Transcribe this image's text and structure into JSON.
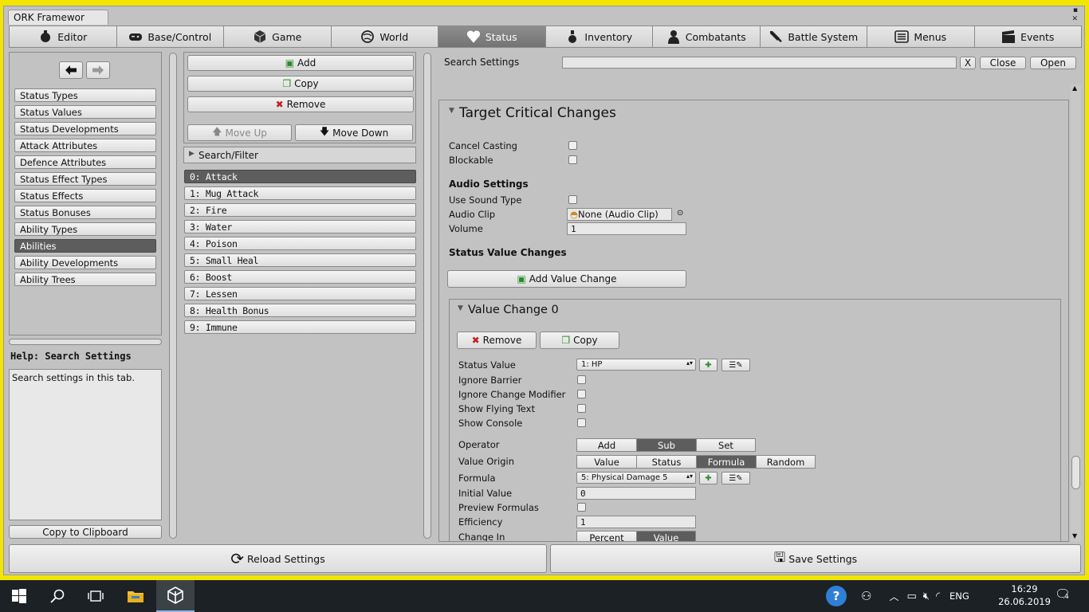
{
  "window": {
    "tab_title": "ORK Framewor",
    "controls": "▪ ✕"
  },
  "nav_tabs": [
    {
      "label": "Editor",
      "icon": "editor-icon"
    },
    {
      "label": "Base/Control",
      "icon": "gamepad-icon"
    },
    {
      "label": "Game",
      "icon": "cube-icon"
    },
    {
      "label": "World",
      "icon": "globe-icon"
    },
    {
      "label": "Status",
      "icon": "heart-icon",
      "active": true
    },
    {
      "label": "Inventory",
      "icon": "potion-icon"
    },
    {
      "label": "Combatants",
      "icon": "person-icon"
    },
    {
      "label": "Battle System",
      "icon": "sword-icon"
    },
    {
      "label": "Menus",
      "icon": "menu-icon"
    },
    {
      "label": "Events",
      "icon": "clapper-icon"
    }
  ],
  "left": {
    "items": [
      "Status Types",
      "Status Values",
      "Status Developments",
      "Attack Attributes",
      "Defence Attributes",
      "Status Effect Types",
      "Status Effects",
      "Status Bonuses",
      "Ability Types",
      "Abilities",
      "Ability Developments",
      "Ability Trees"
    ],
    "selected_index": 9,
    "help_title": "Help: Search Settings",
    "help_text": "Search settings in this tab.",
    "copy_button": "Copy to Clipboard"
  },
  "middle": {
    "add": "Add",
    "copy": "Copy",
    "remove": "Remove",
    "move_up": "Move Up",
    "move_down": "Move Down",
    "search_filter": "Search/Filter",
    "items": [
      "0: Attack",
      "1: Mug Attack",
      "2: Fire",
      "3: Water",
      "4: Poison",
      "5: Small Heal",
      "6: Boost",
      "7: Lessen",
      "8: Health Bonus",
      "9: Immune"
    ],
    "selected_index": 0
  },
  "right": {
    "search_label": "Search Settings",
    "search_value": "",
    "clear": "X",
    "close": "Close",
    "open": "Open",
    "section_title": "Target Critical Changes",
    "cancel_casting": "Cancel Casting",
    "blockable": "Blockable",
    "audio_settings": "Audio Settings",
    "use_sound_type": "Use Sound Type",
    "audio_clip": "Audio Clip",
    "audio_clip_value": "None (Audio Clip)",
    "volume": "Volume",
    "volume_value": "1",
    "status_value_changes": "Status Value Changes",
    "add_value_change": "Add Value Change",
    "value_change_title": "Value Change 0",
    "vc_remove": "Remove",
    "vc_copy": "Copy",
    "status_value": "Status Value",
    "status_value_selected": "1: HP",
    "ignore_barrier": "Ignore Barrier",
    "ignore_change_modifier": "Ignore Change Modifier",
    "show_flying_text": "Show Flying Text",
    "show_console": "Show Console",
    "operator": "Operator",
    "operator_options": [
      "Add",
      "Sub",
      "Set"
    ],
    "operator_selected": 1,
    "value_origin": "Value Origin",
    "value_origin_options": [
      "Value",
      "Status",
      "Formula",
      "Random"
    ],
    "value_origin_selected": 2,
    "formula": "Formula",
    "formula_selected": "5: Physical Damage 5",
    "initial_value": "Initial Value",
    "initial_value_value": "0",
    "preview_formulas": "Preview Formulas",
    "efficiency": "Efficiency",
    "efficiency_value": "1",
    "change_in": "Change In",
    "change_in_options": [
      "Percent",
      "Value"
    ],
    "change_in_selected": 1
  },
  "bottom": {
    "reload": "Reload Settings",
    "save": "Save Settings"
  },
  "taskbar": {
    "lang": "ENG",
    "time": "16:29",
    "date": "26.06.2019",
    "notifications": "4"
  }
}
